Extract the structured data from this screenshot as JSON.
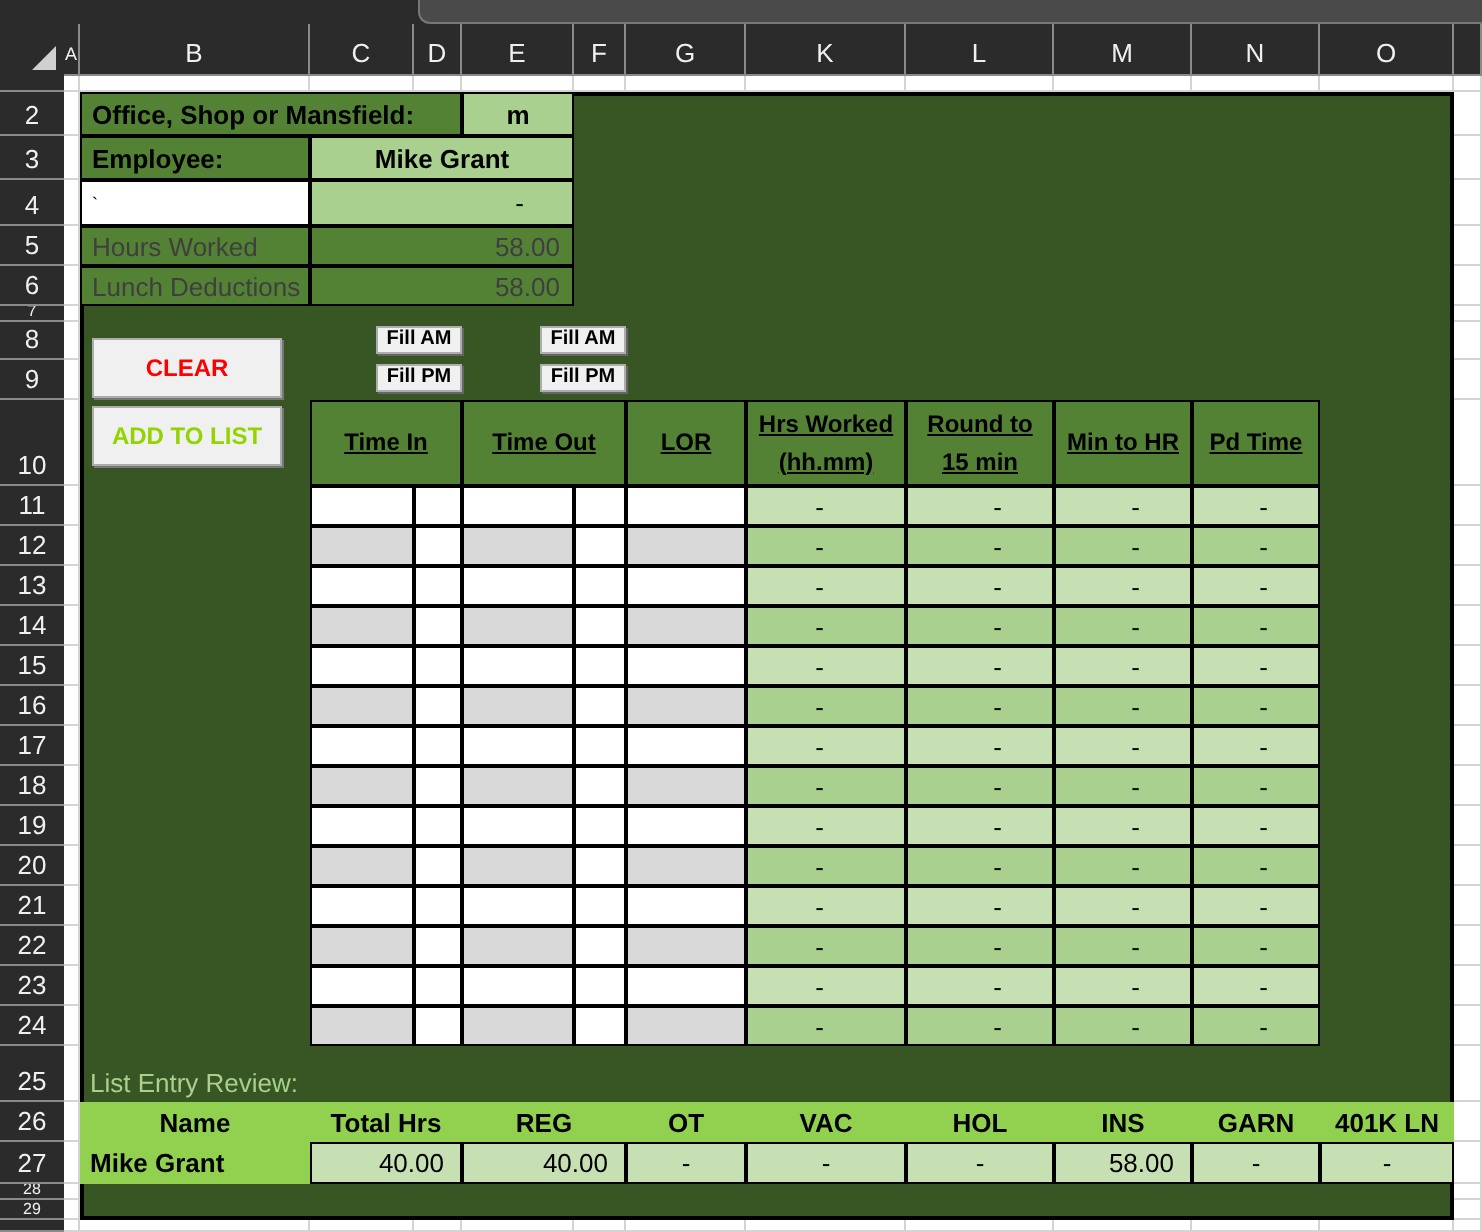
{
  "sheet": {
    "column_headers": [
      "A",
      "B",
      "C",
      "D",
      "E",
      "F",
      "G",
      "K",
      "L",
      "M",
      "N",
      "O"
    ],
    "row_headers": [
      "2",
      "3",
      "4",
      "5",
      "6",
      "7",
      "8",
      "9",
      "10",
      "11",
      "12",
      "13",
      "14",
      "15",
      "16",
      "17",
      "18",
      "19",
      "20",
      "21",
      "22",
      "23",
      "24",
      "25",
      "26",
      "27",
      "28",
      "29"
    ]
  },
  "form": {
    "office_label": "Office, Shop or Mansfield:",
    "office_value": "m",
    "employee_label": "Employee:",
    "employee_value": "Mike Grant",
    "note_mark": "`",
    "note_value": "-",
    "totals": [
      {
        "label": "Hours Worked",
        "value": "58.00"
      },
      {
        "label": "Lunch Deductions",
        "value": "58.00"
      }
    ]
  },
  "buttons": [
    {
      "label": "CLEAR",
      "color": "#ff0000"
    },
    {
      "label": "ADD TO LIST",
      "color": "#92d400"
    }
  ],
  "fill_buttons": [
    [
      "Fill AM",
      "Fill PM"
    ],
    [
      "Fill AM",
      "Fill PM"
    ]
  ],
  "time_table": {
    "columns": [
      {
        "label": "Time In"
      },
      {
        "label": "Time Out"
      },
      {
        "label": "LOR"
      },
      {
        "label": "Hrs Worked (hh.mm)"
      },
      {
        "label": "Round to 15 min"
      },
      {
        "label": "Min to HR"
      },
      {
        "label": "Pd Time"
      }
    ],
    "rows": [
      {
        "shaded": false,
        "values": [
          "-",
          "-",
          "-",
          "-"
        ]
      },
      {
        "shaded": true,
        "values": [
          "-",
          "-",
          "-",
          "-"
        ]
      },
      {
        "shaded": false,
        "values": [
          "-",
          "-",
          "-",
          "-"
        ]
      },
      {
        "shaded": true,
        "values": [
          "-",
          "-",
          "-",
          "-"
        ]
      },
      {
        "shaded": false,
        "values": [
          "-",
          "-",
          "-",
          "-"
        ]
      },
      {
        "shaded": true,
        "values": [
          "-",
          "-",
          "-",
          "-"
        ]
      },
      {
        "shaded": false,
        "values": [
          "-",
          "-",
          "-",
          "-"
        ]
      },
      {
        "shaded": true,
        "values": [
          "-",
          "-",
          "-",
          "-"
        ]
      },
      {
        "shaded": false,
        "values": [
          "-",
          "-",
          "-",
          "-"
        ]
      },
      {
        "shaded": true,
        "values": [
          "-",
          "-",
          "-",
          "-"
        ]
      },
      {
        "shaded": false,
        "values": [
          "-",
          "-",
          "-",
          "-"
        ]
      },
      {
        "shaded": true,
        "values": [
          "-",
          "-",
          "-",
          "-"
        ]
      },
      {
        "shaded": false,
        "values": [
          "-",
          "-",
          "-",
          "-"
        ]
      },
      {
        "shaded": true,
        "values": [
          "-",
          "-",
          "-",
          "-"
        ]
      }
    ]
  },
  "review": {
    "title": "List Entry Review:",
    "columns": [
      "Name",
      "Total Hrs",
      "REG",
      "OT",
      "VAC",
      "HOL",
      "INS",
      "GARN",
      "401K LN"
    ],
    "rows": [
      {
        "name": "Mike Grant",
        "values": [
          "40.00",
          "40.00",
          "-",
          "-",
          "-",
          "58.00",
          "-",
          "-"
        ]
      }
    ]
  }
}
